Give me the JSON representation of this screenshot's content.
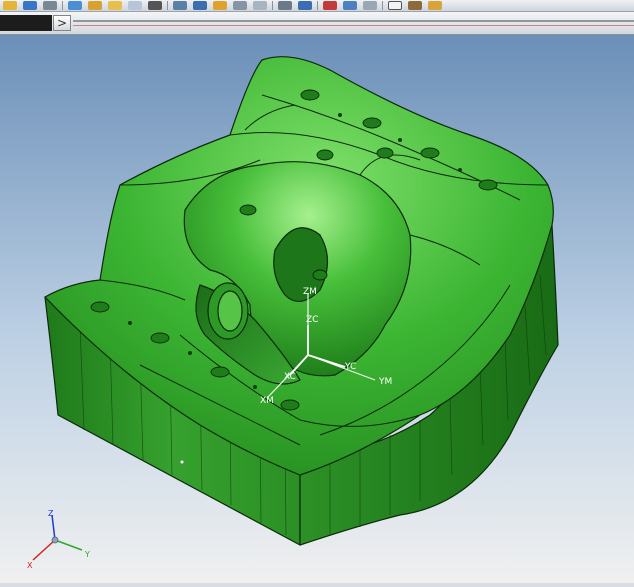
{
  "toolbar": {
    "icons": [
      "open-icon",
      "save-icon",
      "print-icon",
      "undo-icon",
      "cut-icon",
      "copy-icon",
      "paste-icon",
      "delete-icon",
      "snap-icon",
      "measure-icon",
      "layer-icon",
      "view-icon",
      "render-icon",
      "analysis-icon",
      "info-icon",
      "clock-icon",
      "document-icon",
      "settings-icon"
    ],
    "expand_label": ">"
  },
  "viewport": {
    "model_color": "#2fa82a",
    "background_top": "#6b8fb8",
    "background_bottom": "#f0f0f0",
    "wcs_labels": {
      "zm": "ZM",
      "zc": "ZC",
      "yc": "YC",
      "ym": "YM",
      "xc": "XC",
      "xm": "XM"
    },
    "triad_labels": {
      "z": "Z",
      "y": "Y",
      "x": "X"
    }
  }
}
